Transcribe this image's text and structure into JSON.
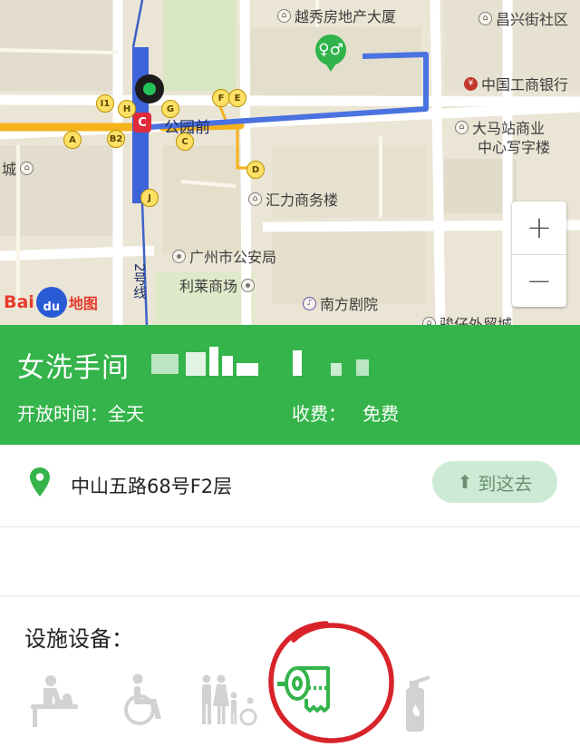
{
  "map": {
    "pois": [
      {
        "name": "越秀房地产大厦",
        "kind": "building"
      },
      {
        "name": "昌兴街社区",
        "kind": "building"
      },
      {
        "name": "中国工商银行",
        "kind": "bank"
      },
      {
        "name": "大马站商业",
        "kind": "building"
      },
      {
        "name": "中心写字楼",
        "kind": "none"
      },
      {
        "name": "公园前",
        "kind": "none"
      },
      {
        "name": "汇力商务楼",
        "kind": "building"
      },
      {
        "name": "广州市公安局",
        "kind": "dot"
      },
      {
        "name": "利莱商场",
        "kind": "dot"
      },
      {
        "name": "南方剧院",
        "kind": "music"
      },
      {
        "name": "骏仔外贸城",
        "kind": "building"
      },
      {
        "name": "城",
        "kind": "building"
      }
    ],
    "subway_exits": [
      "I1",
      "H",
      "G",
      "F",
      "E",
      "A",
      "B2",
      "C",
      "D",
      "J"
    ],
    "metro_line_label": "2号线",
    "zoom_in": "+",
    "zoom_out": "−",
    "brand": {
      "part1": "Bai",
      "part2": "du",
      "part3": "地图"
    }
  },
  "poi_detail": {
    "name": "女洗手间",
    "hours_label": "开放时间：全天",
    "fee_label": "收费：",
    "fee_value": "免费",
    "address": "中山五路68号F2层",
    "navigate_label": "到这去"
  },
  "facilities": {
    "title": "设施设备：",
    "items": [
      {
        "icon": "baby-changing-icon",
        "available": false
      },
      {
        "icon": "wheelchair-icon",
        "available": false
      },
      {
        "icon": "family-accessible-icon",
        "available": false
      },
      {
        "icon": "toilet-paper-icon",
        "available": true,
        "highlighted": true
      },
      {
        "icon": "fire-extinguisher-icon",
        "available": false
      }
    ]
  },
  "colors": {
    "accent_green": "#34b44a",
    "route_blue": "#4a72e0",
    "metro_orange": "#f5b21a",
    "highlight_circle": "#d8232a",
    "inactive_icon": "#cfcfcf"
  }
}
